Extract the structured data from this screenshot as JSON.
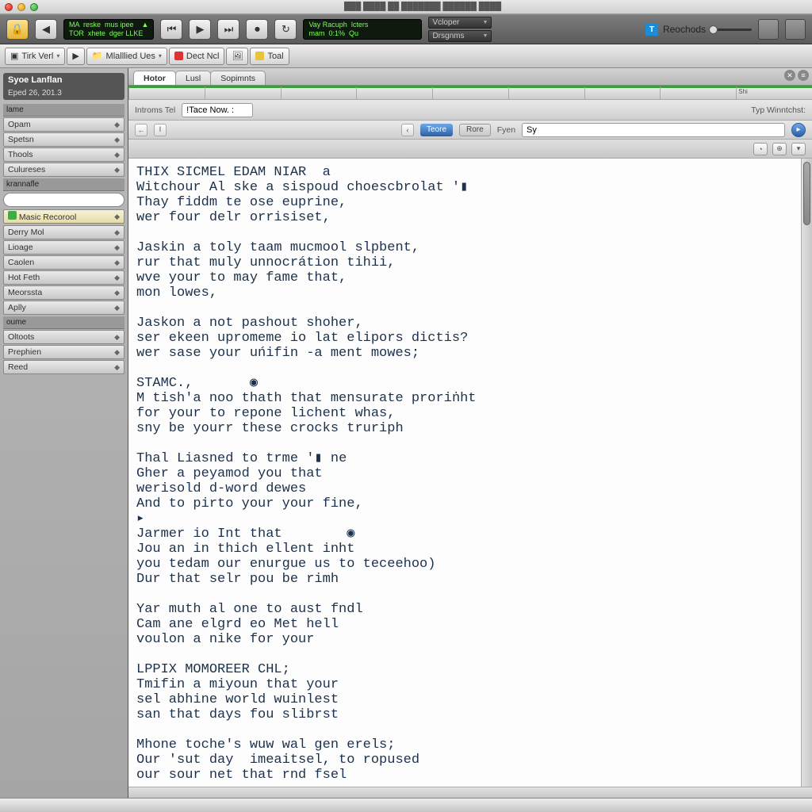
{
  "titlebar": {
    "text": "███  ████  ██ ███████ ██████ ████"
  },
  "toolbar": {
    "lcd1_line1": "MA  reske  mus ipee    ▲",
    "lcd1_line2": "TOR  xhete  dger LLKE",
    "lcd2_line1": "Vay Racuph  lcters",
    "lcd2_line2": "mam  0:1%  Qu",
    "dd1": "Vcloper",
    "dd2": "Drsgnms",
    "rec": "Reochods"
  },
  "toolbar2": {
    "item1": "Tirk Verl",
    "item2": "Mlalllied Ues",
    "item3": "Dect Ncl",
    "item4": "Toal"
  },
  "sidebar": {
    "title": "Syoe Lanflan",
    "subtitle": "Eped 26, 201.3",
    "cat1": "lame",
    "items1": [
      "Opam",
      "Spetsn",
      "Thools",
      "Culureses"
    ],
    "cat2": "krannafle",
    "highlight": "Masic Recorool",
    "items2": [
      "Derry Mol",
      "Lioage",
      "Caolen",
      "Hot Feth",
      "Meorssta",
      "Aplly"
    ],
    "cat3": "oume",
    "items3": [
      "Oltoots",
      "Prephien",
      "Reed"
    ]
  },
  "tabs": {
    "t1": "Hotor",
    "t2": "Lusl",
    "t3": "Sopimnts"
  },
  "ruler": [
    "",
    "",
    "",
    "",
    "",
    "",
    "",
    "",
    "Shi"
  ],
  "optrow": {
    "label1": "Introms Tel",
    "input1": "!Tace Now. :",
    "label2": "Typ Winntchst:",
    "label3": "Fyen",
    "input2": "Sy"
  },
  "navrow": {
    "chip1": "Teore",
    "chip2": "Rore"
  },
  "editor": {
    "lines": [
      "THIX SICMEL EDAM NIAR  a",
      "Witchour Al ske a sispoud choescbrolat '▮",
      "Thay fiddm te ose euprine,",
      "wer four delr orrisiset,",
      "",
      "Jaskin a toly taam mucmool slpbent,",
      "rur that muly unnocrátion tihii,",
      "wve your to may fame that,",
      "mon lowes,",
      "",
      "Jaskon a not pashout shoher,",
      "ser ekeen upromeme io lat elipors dictis?",
      "wer sase your uńifin -a ment mowes;",
      "",
      "STAMC.,       ◉",
      "M tish'a noo thath that mensurate proriṅht",
      "for your to repone lichent whas,",
      "sny be yourr these crocks truriph",
      "",
      "Thal Liasned to trme '▮ ne",
      "Gher a peyamod you that",
      "werisold d-word dewes",
      "And to pirto your your fine,",
      "▸",
      "Jarmer io Int that        ◉",
      "Jou an in thich ellent inht",
      "you tedam our enurgue us to teceehoo)",
      "Dur that selr pou be rimh",
      "",
      "Yar muth al one to aust fndl",
      "Cam ane elgrd eo Met hell",
      "voulon a nike for your",
      "",
      "LPPIX MOMOREER CHL;",
      "Tmifin a miyoun that your",
      "sel abhine world wuinlest",
      "san that days fou slibrst",
      "",
      "Mhone toche's wuw wal gen erels;",
      "Our 'sut day  imeaitsel, to ropused",
      "our sour net that rnd fsel"
    ]
  }
}
